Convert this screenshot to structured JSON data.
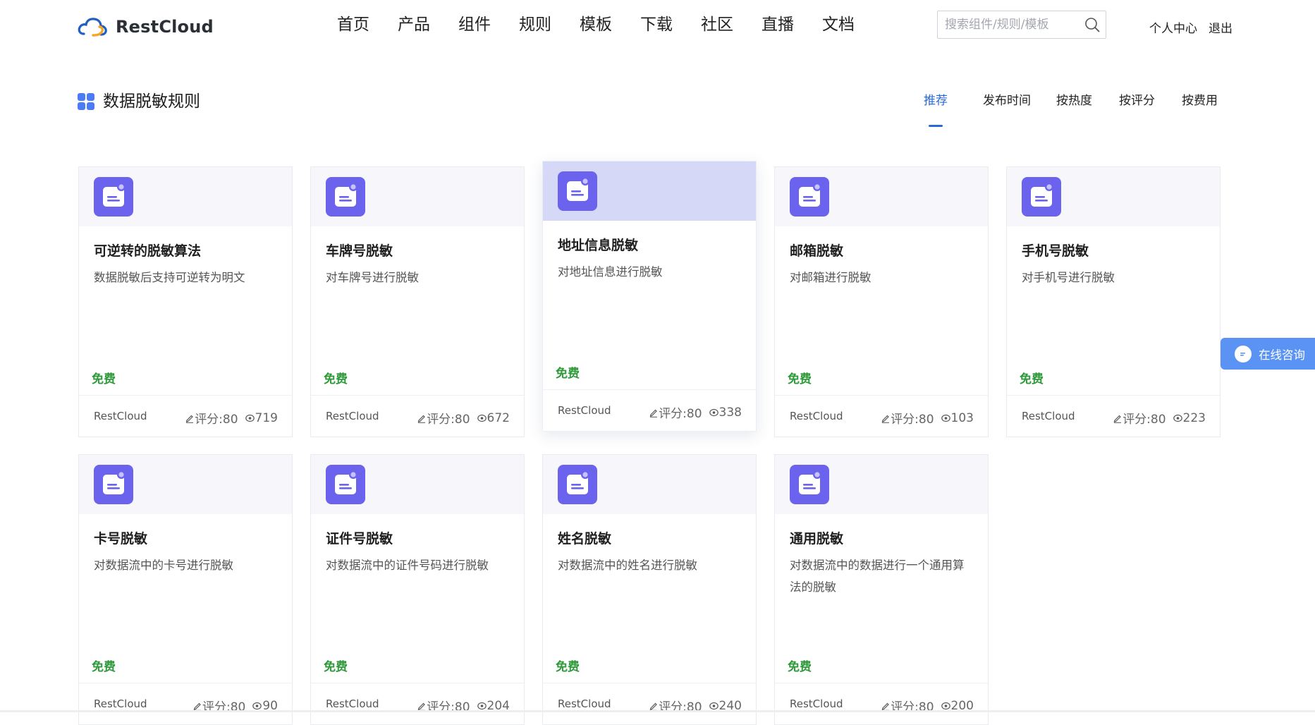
{
  "header": {
    "brand": "RestCloud",
    "nav": [
      "首页",
      "产品",
      "组件",
      "规则",
      "模板",
      "下载",
      "社区",
      "直播",
      "文档"
    ],
    "search": {
      "placeholder": "搜索组件/规则/模板",
      "value": ""
    },
    "user_center": "个人中心",
    "logout": "退出"
  },
  "section": {
    "title": "数据脱敏规则",
    "sort_tabs": [
      "推荐",
      "发布时间",
      "按热度",
      "按评分",
      "按费用"
    ],
    "active_sort": "推荐"
  },
  "cards": [
    {
      "title": "可逆转的脱敏算法",
      "desc": "数据脱敏后支持可逆转为明文",
      "price": "免费",
      "author": "RestCloud",
      "rating": "评分:80",
      "views": "719"
    },
    {
      "title": "车牌号脱敏",
      "desc": "对车牌号进行脱敏",
      "price": "免费",
      "author": "RestCloud",
      "rating": "评分:80",
      "views": "672"
    },
    {
      "title": "地址信息脱敏",
      "desc": "对地址信息进行脱敏",
      "price": "免费",
      "author": "RestCloud",
      "rating": "评分:80",
      "views": "338",
      "hovered": true
    },
    {
      "title": "邮箱脱敏",
      "desc": "对邮箱进行脱敏",
      "price": "免费",
      "author": "RestCloud",
      "rating": "评分:80",
      "views": "103"
    },
    {
      "title": "手机号脱敏",
      "desc": "对手机号进行脱敏",
      "price": "免费",
      "author": "RestCloud",
      "rating": "评分:80",
      "views": "223"
    },
    {
      "title": "卡号脱敏",
      "desc": "对数据流中的卡号进行脱敏",
      "price": "免费",
      "author": "RestCloud",
      "rating": "评分:80",
      "views": "90"
    },
    {
      "title": "证件号脱敏",
      "desc": "对数据流中的证件号码进行脱敏",
      "price": "免费",
      "author": "RestCloud",
      "rating": "评分:80",
      "views": "204"
    },
    {
      "title": "姓名脱敏",
      "desc": "对数据流中的姓名进行脱敏",
      "price": "免费",
      "author": "RestCloud",
      "rating": "评分:80",
      "views": "240"
    },
    {
      "title": "通用脱敏",
      "desc": "对数据流中的数据进行一个通用算法的脱敏",
      "price": "免费",
      "author": "RestCloud",
      "rating": "评分:80",
      "views": "200"
    }
  ],
  "consult": {
    "label": "在线咨询"
  },
  "colors": {
    "accent": "#2a6ad8",
    "card_icon": "#6b63ee",
    "price_free": "#2f9a3a",
    "consult_bg": "#5b93f5",
    "hover_card_top": "#d6d8f8"
  },
  "icons": {
    "brand": "cloud-logo-icon",
    "search": "search-icon",
    "section": "grid-icon",
    "card": "document-bot-icon",
    "rating": "edit-pencil-icon",
    "views": "eye-icon",
    "consult": "chat-bubble-icon"
  }
}
